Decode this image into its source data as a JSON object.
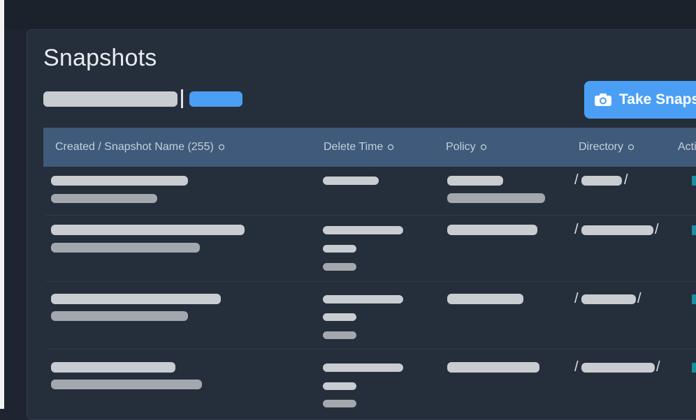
{
  "page": {
    "title": "Snapshots"
  },
  "toolbar": {
    "take_snapshot_label": "Take Snapshot"
  },
  "table": {
    "columns": [
      {
        "label": "Created / Snapshot Name (255)",
        "sortable": true
      },
      {
        "label": "Delete Time",
        "sortable": true
      },
      {
        "label": "Policy",
        "sortable": true
      },
      {
        "label": "Directory",
        "sortable": true
      },
      {
        "label": "Actions",
        "sortable": false
      }
    ],
    "rows": [
      {
        "directory_prefix": "/",
        "directory_suffix": "/"
      },
      {
        "directory_prefix": "/",
        "directory_suffix": "/"
      },
      {
        "directory_prefix": "/",
        "directory_suffix": "/"
      },
      {
        "directory_prefix": "/",
        "directory_suffix": "/"
      }
    ]
  },
  "colors": {
    "accent": "#4a9ff5",
    "header_bg": "#3f5a7a",
    "panel_bg": "#252e3b",
    "page_bg": "#1e2530"
  },
  "icons": {
    "take_snapshot": "camera-icon",
    "sort": "sort-icon"
  }
}
